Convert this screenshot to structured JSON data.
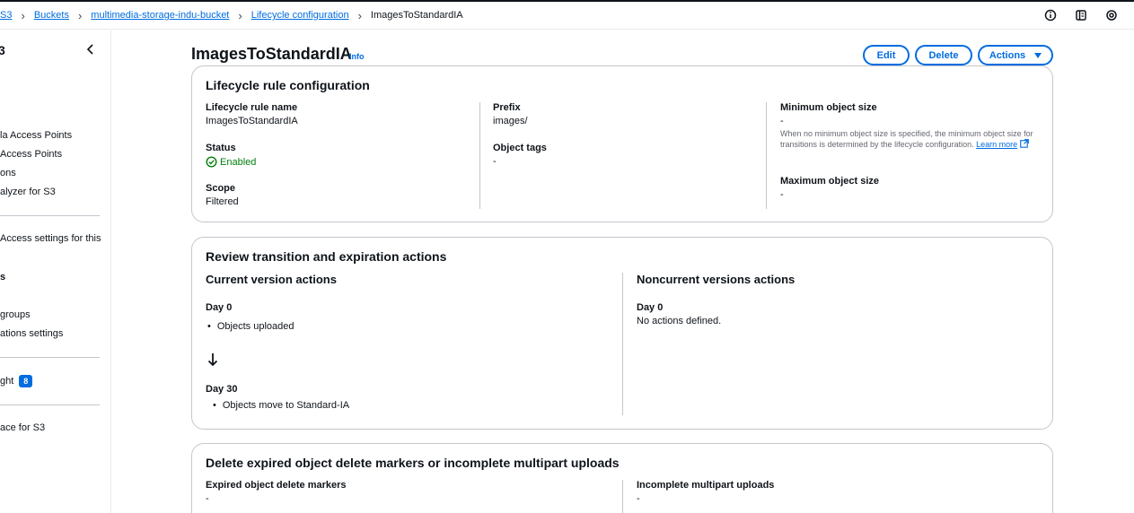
{
  "breadcrumb": {
    "items": [
      "S3",
      "Buckets",
      "multimedia-storage-indu-bucket",
      "Lifecycle configuration"
    ],
    "current": "ImagesToStandardIA"
  },
  "top_icons": [
    "info-circle-icon",
    "notifications-panel-icon",
    "settings-cog-icon"
  ],
  "sidebar": {
    "title": "3",
    "items": [
      "la Access Points",
      "Access Points",
      "ons",
      "alyzer for S3",
      "Access settings for this",
      "s",
      "groups",
      "ations settings",
      "ght",
      "ace for S3"
    ],
    "badge": "8"
  },
  "page": {
    "title": "ImagesToStandardIA",
    "info": "Info",
    "buttons": {
      "edit": "Edit",
      "delete": "Delete",
      "actions": "Actions"
    }
  },
  "config": {
    "heading": "Lifecycle rule configuration",
    "rule_name_label": "Lifecycle rule name",
    "rule_name": "ImagesToStandardIA",
    "status_label": "Status",
    "status": "Enabled",
    "scope_label": "Scope",
    "scope": "Filtered",
    "prefix_label": "Prefix",
    "prefix": "images/",
    "tags_label": "Object tags",
    "tags": "-",
    "min_size_label": "Minimum object size",
    "min_size": "-",
    "min_size_note": "When no minimum object size is specified, the minimum object size for transitions is determined by the lifecycle configuration.",
    "learn_more": "Learn more",
    "max_size_label": "Maximum object size",
    "max_size": "-"
  },
  "review": {
    "heading": "Review transition and expiration actions",
    "current_heading": "Current version actions",
    "day0_label": "Day 0",
    "day0_action": "Objects uploaded",
    "day30_label": "Day 30",
    "day30_action": "Objects move to Standard-IA",
    "noncurrent_heading": "Noncurrent versions actions",
    "noncurrent_day_label": "Day 0",
    "noncurrent_text": "No actions defined."
  },
  "expired": {
    "heading": "Delete expired object delete markers or incomplete multipart uploads",
    "markers_label": "Expired object delete markers",
    "markers_value": "-",
    "multipart_label": "Incomplete multipart uploads",
    "multipart_value": "-"
  },
  "colors": {
    "accent": "#006ce0",
    "success": "#037f0c",
    "border": "#c6c6cd",
    "text": "#0f141a"
  }
}
